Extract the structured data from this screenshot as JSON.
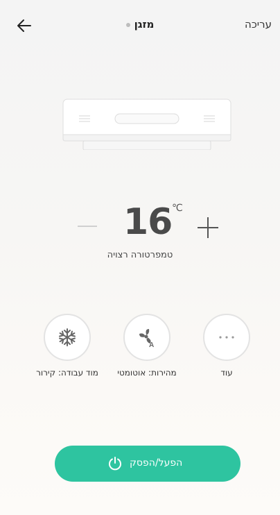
{
  "header": {
    "title": "מזגן",
    "edit_label": "עריכה"
  },
  "temperature": {
    "value": "16",
    "unit": "℃",
    "label": "טמפרטורה רצויה"
  },
  "controls": {
    "more_label": "עוד",
    "speed_label": "מהירות: אוטומטי",
    "mode_label": "מוד עבודה: קירור"
  },
  "power": {
    "label": "הפעל/הפסק"
  },
  "colors": {
    "accent": "#2ec4a0",
    "background": "#f6f5f3",
    "text": "#333333"
  },
  "icons": {
    "back": "arrow-left-icon",
    "more": "more-dots-icon",
    "speed": "fan-auto-icon",
    "mode": "snowflake-icon",
    "power": "power-icon"
  }
}
